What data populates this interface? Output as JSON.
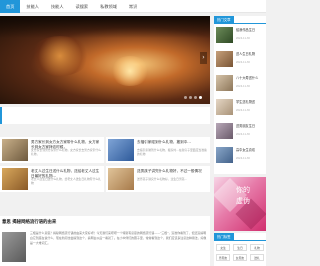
{
  "nav": {
    "items": [
      "首页",
      "技能人",
      "技能人",
      "读搜索",
      "私教领域",
      "常识"
    ]
  },
  "slider": {
    "arrow": "›"
  },
  "cards": [
    {
      "title": "男方家长到女方女方家带什么礼物，女方家长到女方家拜访时候，",
      "desc": "女方家长到男方家带什么礼物，女方家长去男方家带什么礼物，"
    },
    {
      "title": "去福引家碰到什么礼物，搬到中...",
      "desc": "去福引家碰到什么礼物，搬家时...在新房子里面应当准备的礼物"
    },
    {
      "title": "老丈人过生日送什么礼物，送给老丈人过生日最好的礼物...",
      "desc": "老丈人过生日送什么礼物，给老丈人送生日礼物有什么礼物"
    },
    {
      "title": "送男孩子讲究什么礼物好，不过一般情况",
      "desc": "送男孩子讲究什么礼物好，过生日男孩..."
    }
  ],
  "article": {
    "title": "意思 揭秘网络流行语的由来",
    "text": "三根是什么意思？揭秘网络流行语的由来大家好呀！今天我们来唠唠一个特别有意思的网络流行语——\"三根\"，没准你看到了，但还没搞明白它到底在说什么，现在新闻也会提到这个，搞明白以后一看就了。在小伙伴们的圈子里，常常看到这个，我们应该多注意这种用法，好像是一大堆词汇。"
  },
  "sidebar": {
    "heading": "热门文章",
    "items": [
      {
        "title": "给我作品生日",
        "date": "2024-11-30"
      },
      {
        "title": "送人生日礼物",
        "date": "2024-11-30"
      },
      {
        "title": "八十大寿送什么",
        "date": "2024-11-30"
      },
      {
        "title": "学生送礼物送",
        "date": "2024-11-30"
      },
      {
        "title": "送男朋友生日",
        "date": "2024-11-30"
      },
      {
        "title": "高中女生喜欢",
        "date": "2024-11-30"
      }
    ]
  },
  "promo": {
    "line1": "你的",
    "line2": "虚伪"
  },
  "tags": {
    "heading": "热门标签",
    "items": [
      "女生",
      "生日",
      "礼物",
      "男朋友",
      "女朋友",
      "送礼"
    ]
  },
  "colors": {
    "accent": "#2196d9",
    "promo": "#e67aa8"
  }
}
